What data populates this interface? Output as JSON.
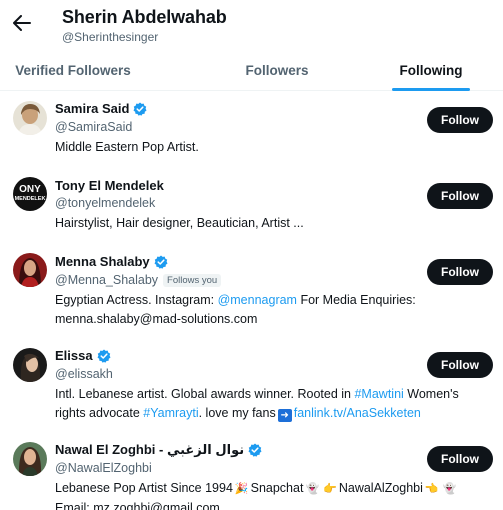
{
  "header": {
    "title": "Sherin Abdelwahab",
    "handle": "@Sherinthesinger"
  },
  "tabs": [
    {
      "label": "Verified Followers",
      "active": false
    },
    {
      "label": "Followers",
      "active": false
    },
    {
      "label": "Following",
      "active": true
    }
  ],
  "colors": {
    "accent": "#1d9bf0",
    "text": "#0f1419",
    "muted": "#536471",
    "button": "#0f1419"
  },
  "users": [
    {
      "name": "Samira Said",
      "verified": true,
      "handle": "@SamiraSaid",
      "bio": "Middle Eastern Pop Artist.",
      "follow_label": "Follow"
    },
    {
      "name": "Tony El Mendelek",
      "verified": false,
      "handle": "@tonyelmendelek",
      "bio": "Hairstylist, Hair designer, Beautician, Artist ...",
      "avatar_text": [
        "ONY",
        "MENDELEK"
      ],
      "follow_label": "Follow"
    },
    {
      "name": "Menna Shalaby",
      "verified": true,
      "handle": "@Menna_Shalaby",
      "follows_you": "Follows you",
      "bio_line1_prefix": "Egyptian Actress. Instagram: ",
      "bio_line1_link": "@mennagram",
      "bio_line1_suffix": " For Media Enquiries:",
      "bio_line2": "menna.shalaby@mad-solutions.com",
      "follow_label": "Follow"
    },
    {
      "name": "Elissa",
      "verified": true,
      "handle": "@elissakh",
      "bio_line1_prefix": "Intl. Lebanese artist. Global awards winner. Rooted in ",
      "bio_line1_link": "#Mawtini",
      "bio_line1_suffix": " Women's",
      "bio_line2_prefix": "rights advocate ",
      "bio_line2_link": "#Yamrayti",
      "bio_line2_mid": ". love my fans",
      "bio_line2_link2": "fanlink.tv/AnaSekketen",
      "follow_label": "Follow"
    },
    {
      "name": "Nawal El Zoghbi - نوال الزغبي",
      "verified": true,
      "handle": "@NawalElZoghbi",
      "bio_line1_a": "Lebanese Pop Artist Since 1994",
      "bio_line1_b": "Snapchat",
      "bio_line1_c": "NawalAlZoghbi",
      "bio_line2": "Email: mz.zoghbi@gmail.com",
      "follow_label": "Follow"
    }
  ]
}
